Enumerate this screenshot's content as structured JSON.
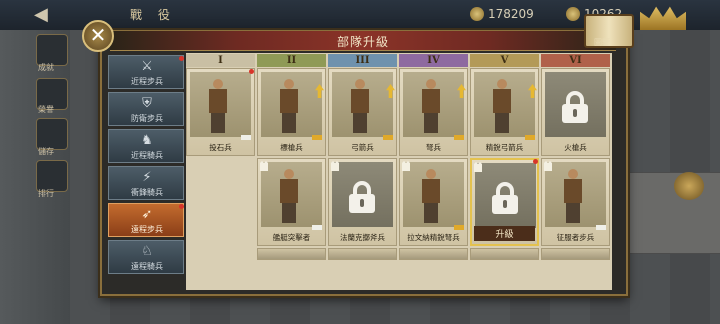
{
  "background": {
    "title": "戰 役",
    "resource_1": "178209",
    "resource_2": "10262",
    "side_labels": [
      "成就",
      "榮譽",
      "儲存",
      "排行"
    ]
  },
  "panel": {
    "title": "部隊升級",
    "book_label": "圖鑒"
  },
  "categories": [
    {
      "label": "近程步兵",
      "icon": "crossed-swords-icon",
      "glyph": "⚔",
      "active": false,
      "alert": true
    },
    {
      "label": "防衛步兵",
      "icon": "shield-icon",
      "glyph": "⛨",
      "active": false,
      "alert": false
    },
    {
      "label": "近程騎兵",
      "icon": "horse-icon",
      "glyph": "♞",
      "active": false,
      "alert": false
    },
    {
      "label": "衝鋒騎兵",
      "icon": "lance-icon",
      "glyph": "⚡",
      "active": false,
      "alert": false
    },
    {
      "label": "遠程步兵",
      "icon": "bow-icon",
      "glyph": "➶",
      "active": true,
      "alert": true
    },
    {
      "label": "遠程騎兵",
      "icon": "mounted-archer-icon",
      "glyph": "♘",
      "active": false,
      "alert": false
    }
  ],
  "columns": [
    {
      "numeral": "I",
      "color": "#c9bfa4"
    },
    {
      "numeral": "II",
      "color": "#8f9a56"
    },
    {
      "numeral": "III",
      "color": "#6f92ad"
    },
    {
      "numeral": "IV",
      "color": "#8e6aa0"
    },
    {
      "numeral": "V",
      "color": "#b39a58"
    },
    {
      "numeral": "VI",
      "color": "#b0614a"
    }
  ],
  "row1": [
    {
      "name": "投石兵",
      "locked": false,
      "badge": false,
      "arrow": false,
      "stars": "grey",
      "dot": true
    },
    {
      "name": "標槍兵",
      "locked": false,
      "badge": false,
      "arrow": true,
      "stars": "gold",
      "dot": false
    },
    {
      "name": "弓箭兵",
      "locked": false,
      "badge": false,
      "arrow": true,
      "stars": "gold",
      "dot": false
    },
    {
      "name": "弩兵",
      "locked": false,
      "badge": false,
      "arrow": true,
      "stars": "gold",
      "dot": false
    },
    {
      "name": "精銳弓箭兵",
      "locked": false,
      "badge": false,
      "arrow": true,
      "stars": "gold",
      "dot": false
    },
    {
      "name": "火槍兵",
      "locked": true,
      "badge": false,
      "arrow": false,
      "stars": "none",
      "dot": false
    }
  ],
  "row2": [
    {
      "name": "艦艇突擊者",
      "col": 1,
      "locked": false,
      "badge": true,
      "arrow": false,
      "stars": "grey",
      "dot": false,
      "selected": false
    },
    {
      "name": "法蘭克擲斧兵",
      "col": 2,
      "locked": true,
      "badge": true,
      "arrow": false,
      "stars": "none",
      "dot": false,
      "selected": false
    },
    {
      "name": "拉文納精銳弩兵",
      "col": 3,
      "locked": false,
      "badge": true,
      "arrow": false,
      "stars": "gold",
      "dot": false,
      "selected": false
    },
    {
      "name": "升級",
      "col": 4,
      "locked": true,
      "badge": true,
      "arrow": false,
      "stars": "none",
      "dot": true,
      "selected": true
    },
    {
      "name": "征服者步兵",
      "col": 5,
      "locked": false,
      "badge": true,
      "arrow": false,
      "stars": "grey",
      "dot": false,
      "selected": false
    }
  ]
}
